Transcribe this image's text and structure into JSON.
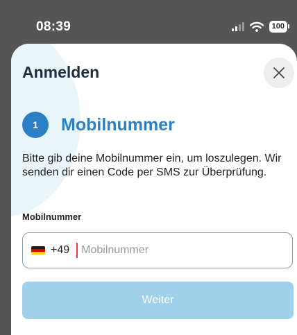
{
  "status_bar": {
    "time": "08:39",
    "battery": "100",
    "icons": [
      "signal-icon",
      "wifi-icon",
      "battery-icon"
    ]
  },
  "sheet": {
    "title": "Anmelden",
    "close_icon": "close-icon"
  },
  "step": {
    "number": "1",
    "title": "Mobilnummer"
  },
  "description": "Bitte gib deine Mobilnummer ein, um loszulegen. Wir senden dir einen Code per SMS zur Überprüfung.",
  "phone": {
    "label": "Mobilnummer",
    "country_flag": "germany-flag-icon",
    "prefix": "+49",
    "placeholder": "Mobilnummer",
    "value": ""
  },
  "submit": {
    "label": "Weiter"
  },
  "colors": {
    "accent": "#2b7fc4",
    "button_disabled": "#9fd1ea",
    "caret": "#e53945",
    "backdrop": "#555555"
  }
}
